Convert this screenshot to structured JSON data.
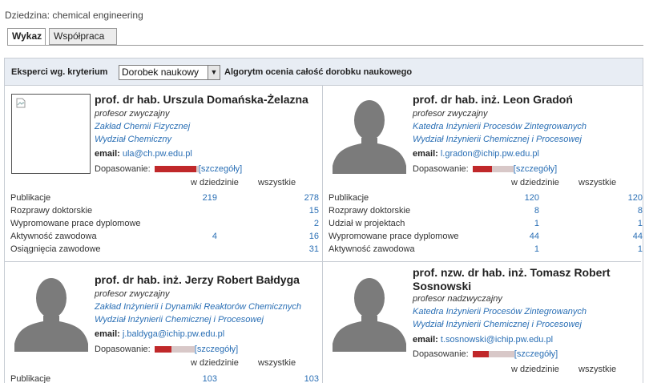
{
  "domain_line": "Dziedzina: chemical engineering",
  "tabs": [
    {
      "label": "Wykaz"
    },
    {
      "label": "Współpraca"
    }
  ],
  "filter": {
    "label": "Eksperci wg. kryterium",
    "select_value": "Dorobek naukowy",
    "description": "Algorytm ocenia całość dorobku naukowego"
  },
  "columns": {
    "field": "w dziedzinie",
    "all": "wszystkie"
  },
  "match_label": "Dopasowanie:",
  "details_label": "[szczegóły]",
  "email_label": "email:",
  "experts": [
    {
      "name": "prof. dr hab. Urszula Domańska-Żelazna",
      "title": "profesor zwyczajny",
      "unit": "Zakład Chemii Fizycznej",
      "faculty": "Wydział Chemiczny",
      "email": "ula@ch.pw.edu.pl",
      "match": 0.95,
      "stats": [
        {
          "label": "Publikacje",
          "field": "219",
          "all": "278"
        },
        {
          "label": "Rozprawy doktorskie",
          "field": "",
          "all": "15"
        },
        {
          "label": "Wypromowane prace dyplomowe",
          "field": "",
          "all": "2"
        },
        {
          "label": "Aktywność zawodowa",
          "field": "4",
          "all": "16"
        },
        {
          "label": "Osiągnięcia zawodowe",
          "field": "",
          "all": "31"
        }
      ]
    },
    {
      "name": "prof. dr hab. inż. Leon Gradoń",
      "title": "profesor zwyczajny",
      "unit": "Katedra Inżynierii Procesów Zintegrowanych",
      "faculty": "Wydział Inżynierii Chemicznej i Procesowej",
      "email": "l.gradon@ichip.pw.edu.pl",
      "match": 0.48,
      "stats": [
        {
          "label": "Publikacje",
          "field": "120",
          "all": "120"
        },
        {
          "label": "Rozprawy doktorskie",
          "field": "8",
          "all": "8"
        },
        {
          "label": "Udział w projektach",
          "field": "1",
          "all": "1"
        },
        {
          "label": "Wypromowane prace dyplomowe",
          "field": "44",
          "all": "44"
        },
        {
          "label": "Aktywność zawodowa",
          "field": "1",
          "all": "1"
        }
      ]
    },
    {
      "name": "prof. dr hab. inż. Jerzy Robert Bałdyga",
      "title": "profesor zwyczajny",
      "unit": "Zakład Inżynierii i Dynamiki Reaktorów Chemicznych",
      "faculty": "Wydział Inżynierii Chemicznej i Procesowej",
      "email": "j.baldyga@ichip.pw.edu.pl",
      "match": 0.42,
      "stats": [
        {
          "label": "Publikacje",
          "field": "103",
          "all": "103"
        }
      ]
    },
    {
      "name": "prof. nzw. dr hab. inż. Tomasz Robert Sosnowski",
      "title": "profesor nadzwyczajny",
      "unit": "Katedra Inżynierii Procesów Zintegrowanych",
      "faculty": "Wydział Inżynierii Chemicznej i Procesowej",
      "email": "t.sosnowski@ichip.pw.edu.pl",
      "match": 0.38,
      "stats": []
    }
  ],
  "colors": {
    "link": "#2a6fb5",
    "bar_fill": "#c0282a",
    "bar_track": "#d8c8c8",
    "toolbar_bg": "#e8edf4",
    "avatar": "#7b7b7b"
  }
}
